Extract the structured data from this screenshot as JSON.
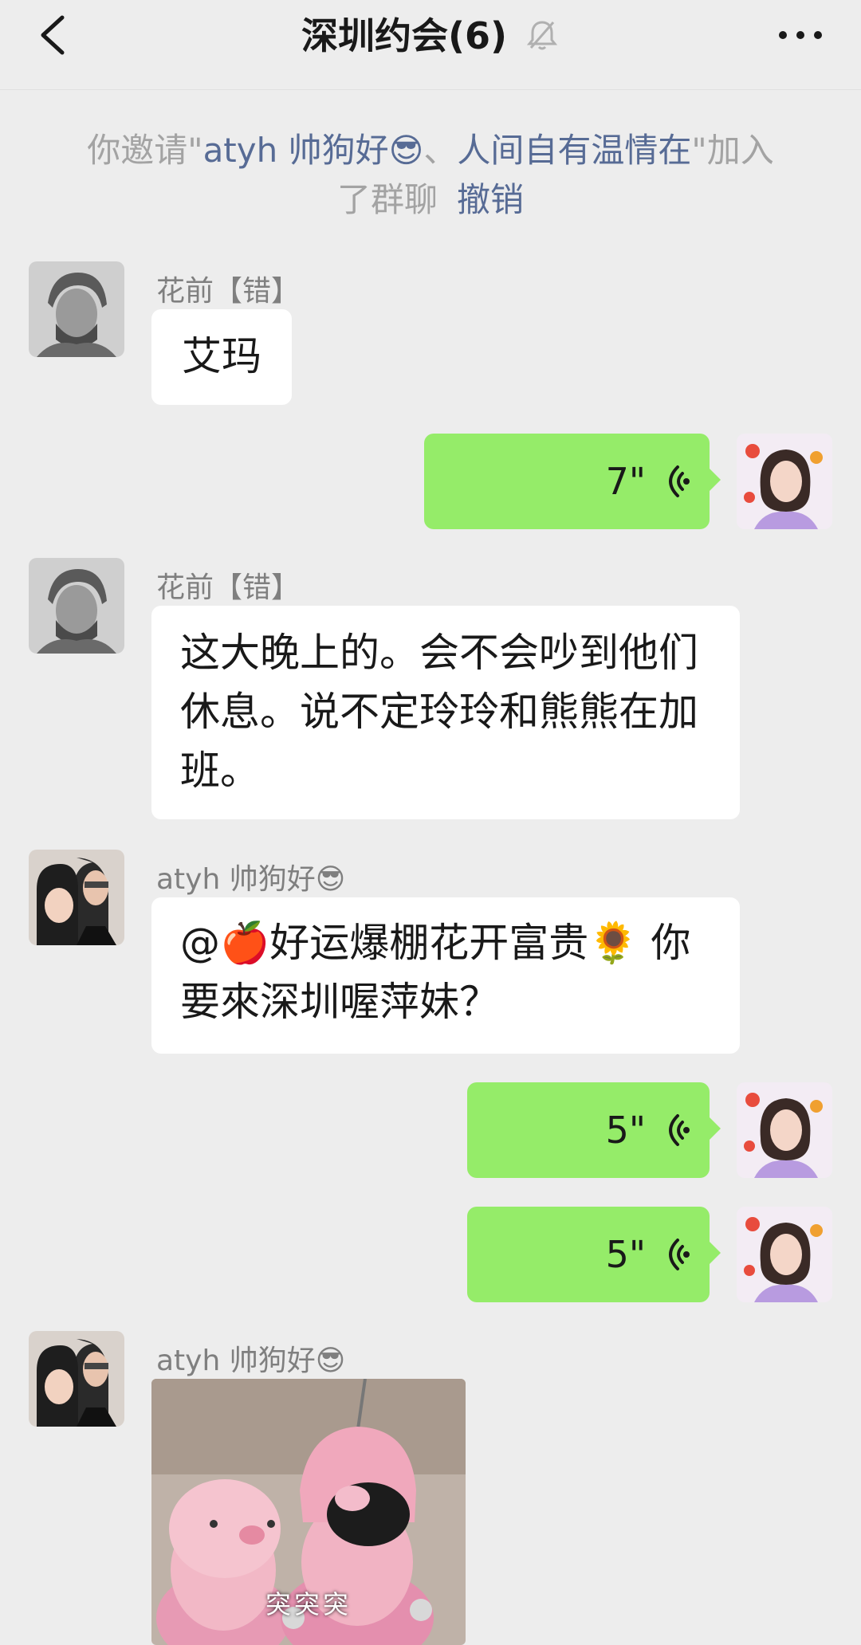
{
  "header": {
    "title": "深圳约会(6)",
    "back_icon": "chevron-left-icon",
    "mute_icon": "bell-off-icon",
    "more_icon": "ellipsis-icon"
  },
  "system_message": {
    "prefix": "你邀请\"",
    "name1": "atyh 帅狗好😎",
    "separator": "、",
    "name2": "人间自有温情在",
    "suffix": "\"加入了群聊",
    "action": "撤销"
  },
  "messages": [
    {
      "sender": "花前【错】",
      "text": "艾玛"
    },
    {
      "self": true,
      "type": "voice",
      "duration": "7\""
    },
    {
      "sender": "花前【错】",
      "text": "这大晚上的。会不会吵到他们休息。说不定玲玲和熊熊在加班。"
    },
    {
      "sender": "atyh 帅狗好😎",
      "text": "@🍎好运爆棚花开富贵🌻 你要來深圳喔萍妹？"
    },
    {
      "self": true,
      "type": "voice",
      "duration": "5\""
    },
    {
      "self": true,
      "type": "voice",
      "duration": "5\""
    },
    {
      "sender": "atyh 帅狗好😎",
      "type": "image",
      "caption": "突突突"
    }
  ],
  "colors": {
    "background": "#ededed",
    "self_bubble": "#95ec69",
    "other_bubble": "#ffffff",
    "link": "#576b95"
  }
}
